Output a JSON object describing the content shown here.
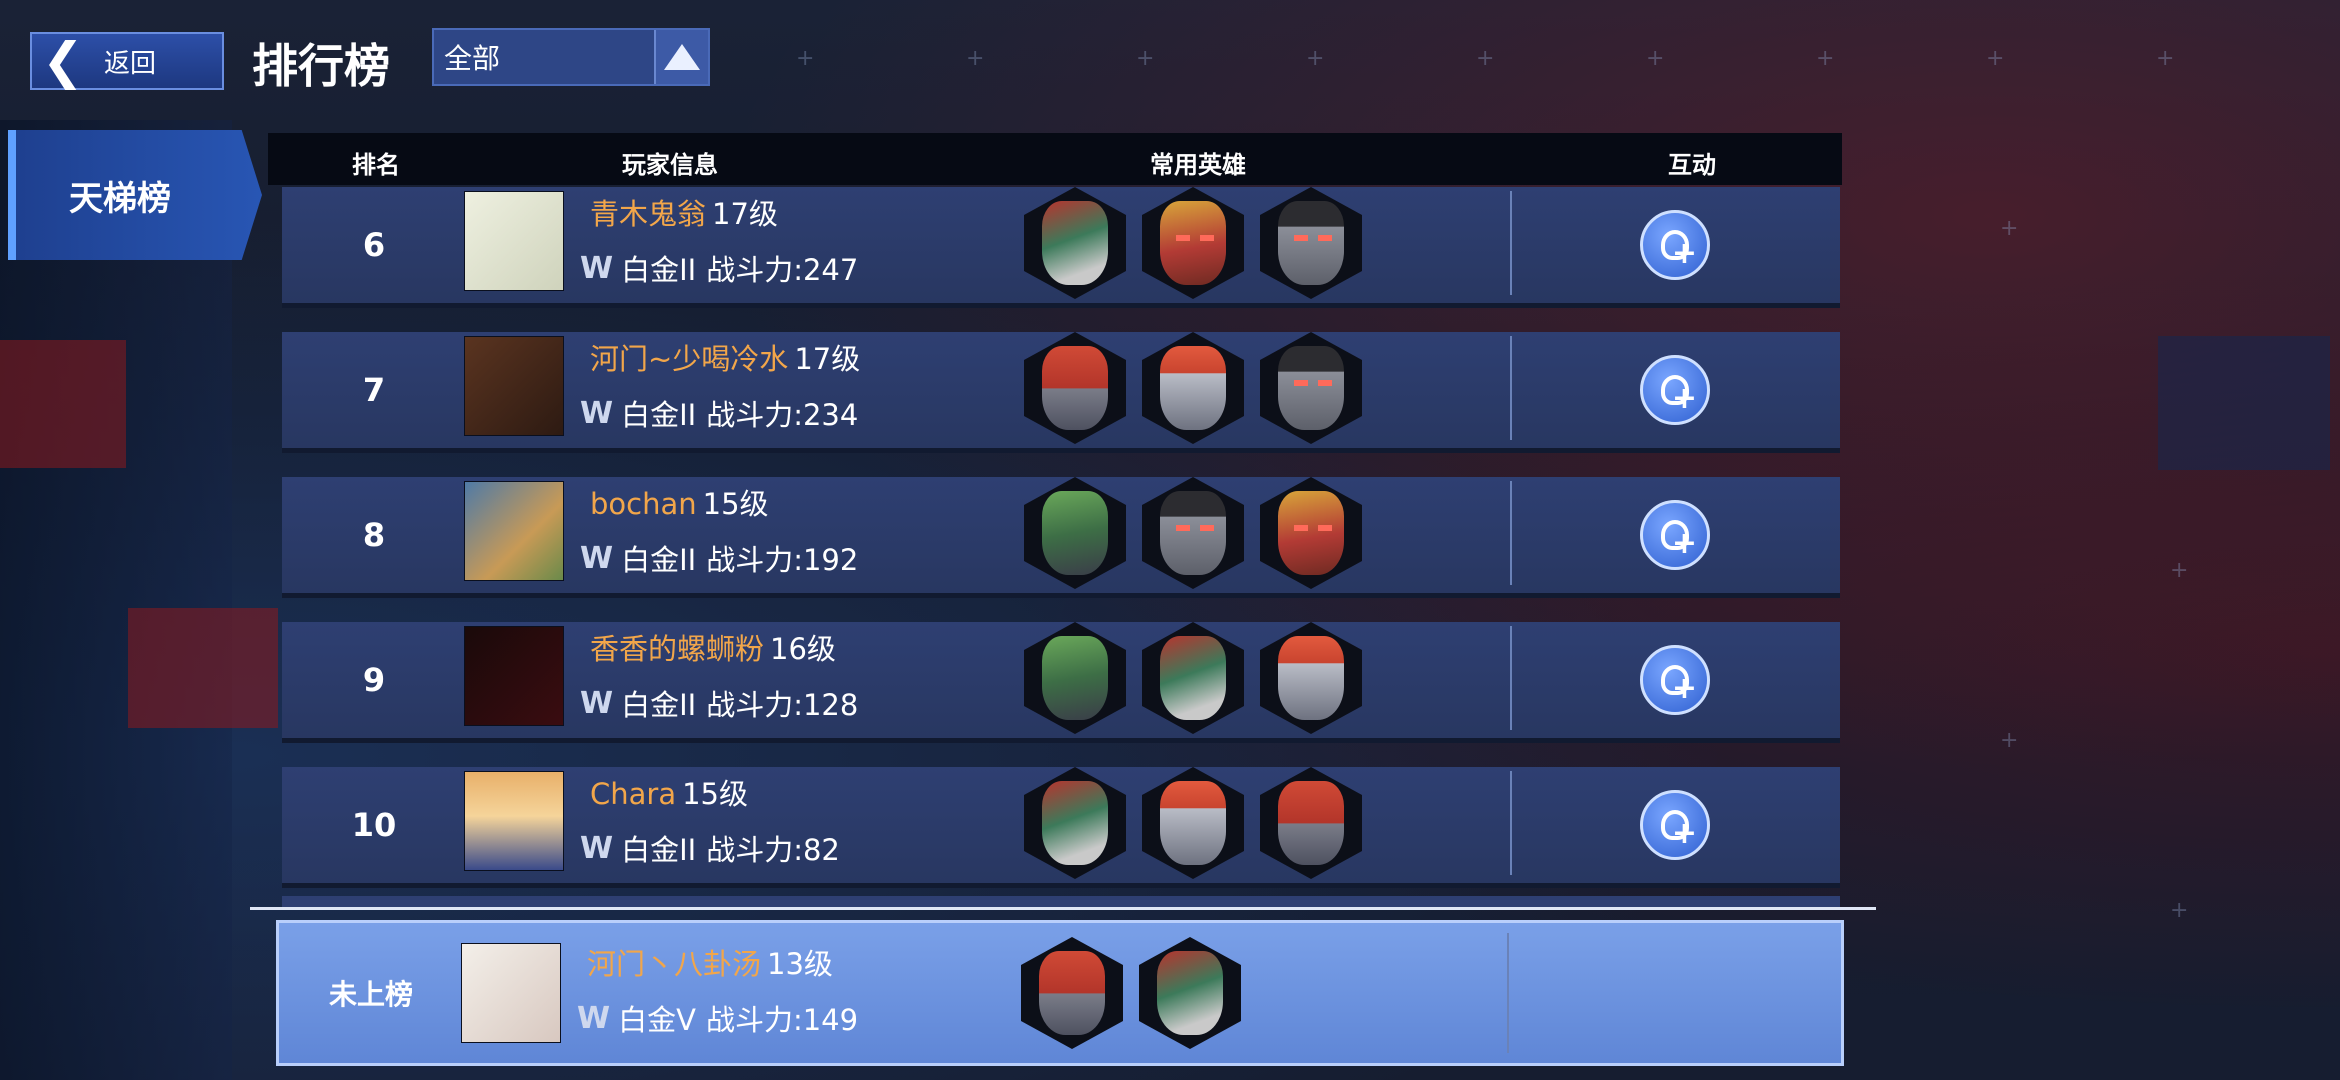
{
  "header": {
    "back_label": "返回",
    "title": "排行榜",
    "filter_value": "全部"
  },
  "side_tabs": [
    {
      "label": "天梯榜",
      "active": true
    }
  ],
  "table": {
    "columns": [
      "排名",
      "玩家信息",
      "常用英雄",
      "互动"
    ],
    "rows": [
      {
        "rank": "6",
        "name": "青木鬼翁",
        "level": "17级",
        "tier": "白金II",
        "power_label": "战斗力:247",
        "heroes": [
          "robot-head-striped",
          "robot-head-gold",
          "robot-head-fedora"
        ]
      },
      {
        "rank": "7",
        "name": "河门~少喝冷水",
        "level": "17级",
        "tier": "白金II",
        "power_label": "战斗力:234",
        "heroes": [
          "robot-head-red",
          "robot-head-cap",
          "robot-head-fedora"
        ]
      },
      {
        "rank": "8",
        "name": "bochan",
        "level": "15级",
        "tier": "白金II",
        "power_label": "战斗力:192",
        "heroes": [
          "robot-head-green",
          "robot-head-fedora",
          "robot-head-gold"
        ]
      },
      {
        "rank": "9",
        "name": "香香的螺蛳粉",
        "level": "16级",
        "tier": "白金II",
        "power_label": "战斗力:128",
        "heroes": [
          "robot-head-green",
          "robot-head-striped",
          "robot-head-cap"
        ]
      },
      {
        "rank": "10",
        "name": "Chara",
        "level": "15级",
        "tier": "白金II",
        "power_label": "战斗力:82",
        "heroes": [
          "robot-head-striped",
          "robot-head-cap",
          "robot-head-red"
        ]
      }
    ],
    "my_row": {
      "rank": "未上榜",
      "name": "河门丶八卦汤",
      "level": "13级",
      "tier": "白金V",
      "power_label": "战斗力:149",
      "heroes": [
        "robot-head-red",
        "robot-head-striped"
      ]
    }
  },
  "icons": {
    "back": "chevron-left-icon",
    "dropdown": "triangle-up-icon",
    "tier": "wings-badge-icon",
    "add_friend": "add-friend-icon"
  },
  "colors": {
    "player_name": "#f2a64a",
    "row_bg": "#2e3f72",
    "my_row_bg": "#6f95e0",
    "header_bg": "#060a14"
  }
}
